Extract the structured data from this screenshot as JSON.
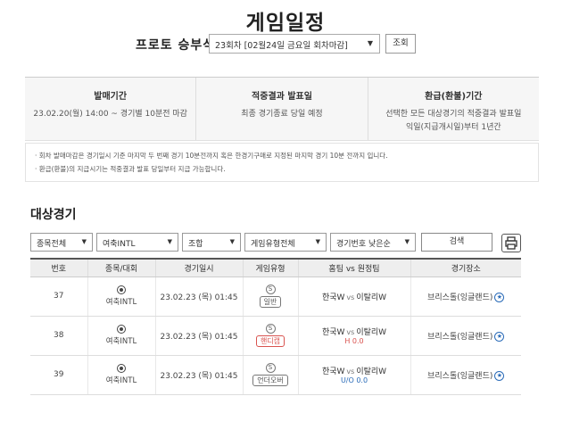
{
  "page": {
    "title": "게임일정"
  },
  "round": {
    "label": "프로토 승부식",
    "selected": "23회차 [02월24일 금요일 회차마감]",
    "lookup_label": "조회"
  },
  "info": [
    {
      "title": "발매기간",
      "lines": [
        "23.02.20(월) 14:00 ~ 경기별 10분전 마감"
      ]
    },
    {
      "title": "적중결과 발표일",
      "lines": [
        "최종 경기종료 당일 예정"
      ]
    },
    {
      "title": "환급(환불)기간",
      "lines": [
        "선택한 모든 대상경기의 적중결과 발표일",
        "익일(지급개시일)부터 1년간"
      ]
    }
  ],
  "notices": [
    "회차 발매마감은 경기일시 기준 마지막 두 번째 경기 10분전까지 혹은 한경기구매로 지정된 마지막 경기 10분 전까지 입니다.",
    "환급(환불)의 지급시기는 적중결과 발표 당일부터 지급 가능합니다."
  ],
  "section": {
    "title": "대상경기"
  },
  "filters": {
    "sport": "종목전체",
    "league": "여축INTL",
    "combo": "조합",
    "game_type": "게임유형전체",
    "sort": "경기번호 낮은순",
    "search_label": "검색"
  },
  "table": {
    "headers": [
      "번호",
      "종목/대회",
      "경기일시",
      "게임유형",
      "홈팀 vs 원정팀",
      "경기장소"
    ],
    "rows": [
      {
        "no": "37",
        "league": "여축INTL",
        "datetime": "23.02.23 (목) 01:45",
        "s": "S",
        "type": "일반",
        "home": "한국W",
        "vs": "vs",
        "away": "이탈리W",
        "handi": "",
        "venue": "브리스톨(잉글랜드)"
      },
      {
        "no": "38",
        "league": "여축INTL",
        "datetime": "23.02.23 (목) 01:45",
        "s": "S",
        "type": "핸디캡",
        "home": "한국W",
        "vs": "vs",
        "away": "이탈리W",
        "handi": "H 0.0",
        "venue": "브리스톨(잉글랜드)"
      },
      {
        "no": "39",
        "league": "여축INTL",
        "datetime": "23.02.23 (목) 01:45",
        "s": "S",
        "type": "언더오버",
        "home": "한국W",
        "vs": "vs",
        "away": "이탈리W",
        "handi": "U/O 0.0",
        "venue": "브리스톨(잉글랜드)"
      }
    ]
  },
  "icons": {
    "print": "printer-icon",
    "venue": "star-icon",
    "sport": "soccer-ball-icon"
  },
  "colors": {
    "accent_red": "#d9534f",
    "accent_blue": "#2a6bb8"
  }
}
